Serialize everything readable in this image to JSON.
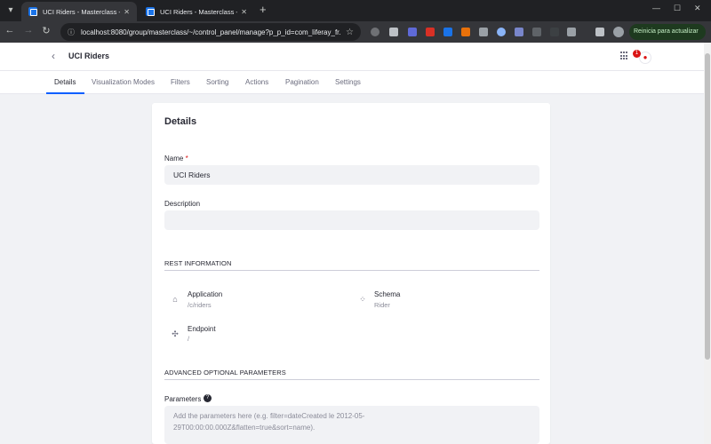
{
  "browser": {
    "tabs": [
      {
        "title": "UCI Riders - Masterclass - Liferay"
      },
      {
        "title": "UCI Riders - Masterclass - Liferay"
      }
    ],
    "new_tab": "+",
    "url": "localhost:8080/group/masterclass/~/control_panel/manage?p_p_id=com_liferay_fr...",
    "update_button": "Reinicia para actualizar"
  },
  "header": {
    "title": "UCI Riders",
    "notification_count": "1"
  },
  "tabs": [
    "Details",
    "Visualization Modes",
    "Filters",
    "Sorting",
    "Actions",
    "Pagination",
    "Settings"
  ],
  "details": {
    "heading": "Details",
    "name_label": "Name",
    "name_required": "*",
    "name_value": "UCI Riders",
    "description_label": "Description",
    "description_value": "",
    "rest_section": "REST INFORMATION",
    "application_label": "Application",
    "application_value": "/c/riders",
    "schema_label": "Schema",
    "schema_value": "Rider",
    "endpoint_label": "Endpoint",
    "endpoint_value": "/",
    "advanced_section": "ADVANCED OPTIONAL PARAMETERS",
    "parameters_label": "Parameters",
    "parameters_placeholder_line1": "Add the parameters here (e.g. filter=dateCreated le 2012-05-",
    "parameters_placeholder_line2": "29T00:00:00.000Z&flatten=true&sort=name)."
  }
}
